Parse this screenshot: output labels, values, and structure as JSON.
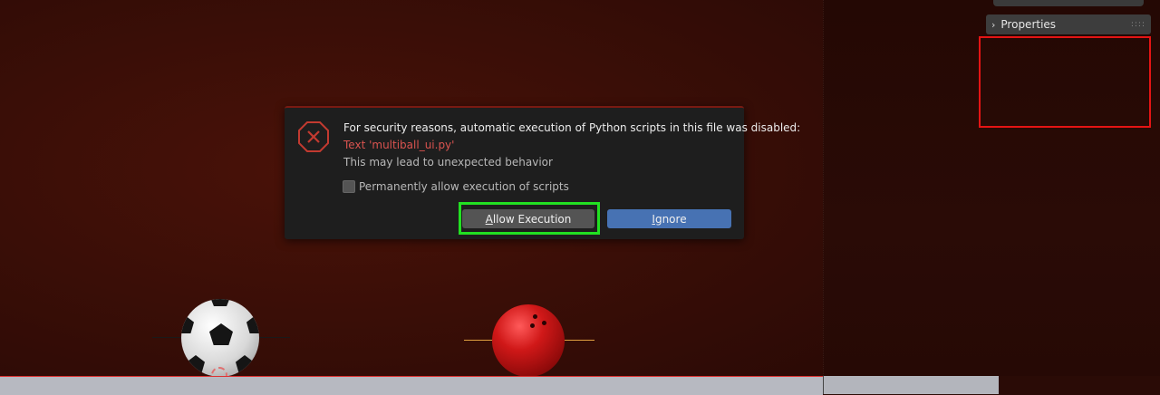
{
  "sidebar": {
    "properties_label": "Properties",
    "chevron_glyph": "›",
    "grip_glyph": "::::"
  },
  "dialog": {
    "title": "For security reasons, automatic execution of Python scripts in this file was disabled:",
    "file_text": "Text 'multiball_ui.py'",
    "warning_text": "This may lead to unexpected behavior",
    "checkbox_label": "Permanently allow execution of scripts",
    "checkbox_checked": false,
    "allow_button": {
      "mnemonic": "A",
      "rest": "llow Execution"
    },
    "ignore_button": {
      "mnemonic": "I",
      "rest": "gnore"
    },
    "icon": "error-octagon-icon"
  },
  "colors": {
    "highlight_red": "#e41414",
    "highlight_green": "#22e022",
    "ignore_button": "#4772b3",
    "allow_button": "#545454",
    "file_text": "#d9534f"
  }
}
